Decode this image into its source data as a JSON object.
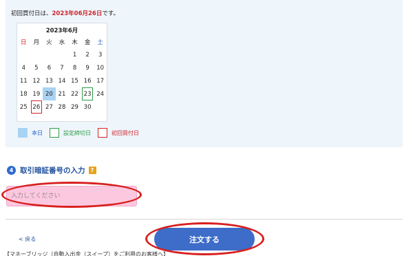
{
  "first_purchase": {
    "prefix": "初回買付日は、",
    "date": "2023年06月26日",
    "suffix": "です。"
  },
  "calendar": {
    "title": "2023年6月",
    "weekdays": [
      "日",
      "月",
      "火",
      "水",
      "木",
      "金",
      "土"
    ],
    "weeks": [
      [
        "",
        "",
        "",
        "",
        "1",
        "2",
        "3"
      ],
      [
        "4",
        "5",
        "6",
        "7",
        "8",
        "9",
        "10"
      ],
      [
        "11",
        "12",
        "13",
        "14",
        "15",
        "16",
        "17"
      ],
      [
        "18",
        "19",
        "20",
        "21",
        "22",
        "23",
        "24"
      ],
      [
        "25",
        "26",
        "27",
        "28",
        "29",
        "30",
        ""
      ]
    ],
    "today": "20",
    "deadline": "23",
    "first_buy": "26"
  },
  "legend": {
    "today": "本日",
    "deadline": "設定締切日",
    "first_buy": "初回買付日"
  },
  "section": {
    "step": "4",
    "title": "取引暗証番号の入力",
    "help": "?"
  },
  "pin": {
    "placeholder": "入力してください"
  },
  "nav": {
    "back": "< 戻る",
    "order": "注文する"
  },
  "footer": {
    "note": "【マネーブリッジ（自動入出金（スイープ）をご利用のお客様へ】"
  },
  "colors": {
    "accent": "#3d6cc9",
    "highlight_ring": "#d8201f",
    "today": "#a9d3f3",
    "deadline": "#2e9d48",
    "first_buy": "#d2232a"
  }
}
